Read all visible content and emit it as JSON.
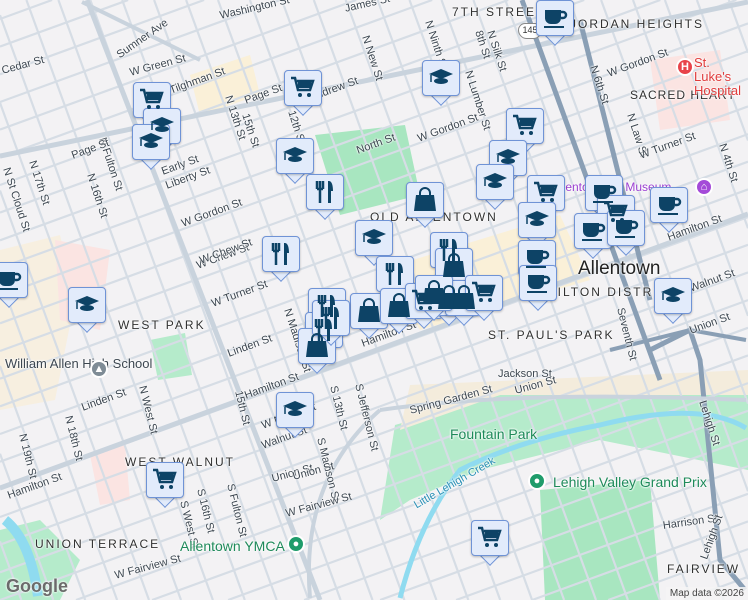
{
  "map": {
    "neighborhoods": [
      "7TH STREET",
      "JORDAN HEIGHTS",
      "SACRED HEART",
      "OLD ALLENTOWN",
      "WEST PARK",
      "ST. PAUL'S PARK",
      "WEST WALNUT",
      "UNION TERRACE",
      "FAIRVIEW",
      "HAMILTON DISTRICT"
    ],
    "city": "Allentown",
    "streets": [
      "Washington St",
      "James St",
      "Sumner Ave",
      "Cedar St",
      "W Green St",
      "Tilghman St",
      "Page St",
      "Andrew St",
      "N 13th St",
      "12th St",
      "N Fulton St",
      "Page St",
      "N 17th St",
      "N 16th St",
      "N St Cloud St",
      "Early St",
      "Liberty St",
      "W Gordon St",
      "W Chew St",
      "North St",
      "N New St",
      "N Ninth St",
      "8th St",
      "N Silk St",
      "N Lumber St",
      "W Gordon St",
      "W Gordon St",
      "N 6th St",
      "N Law St",
      "W Turner St",
      "N 4th St",
      "Hamilton St",
      "Walnut St",
      "Union St",
      "Linden St",
      "Linden St",
      "N Madison St",
      "Hamilton St",
      "Hamilton St",
      "Hamilton St",
      "W Maple St",
      "Walnut St",
      "15th St",
      "S 13th St",
      "S Madison St",
      "S Jefferson St",
      "Union St",
      "W Fairview St",
      "W Fairview St",
      "S Fulton St",
      "S 16th St",
      "S West St",
      "N West St",
      "N 18th St",
      "N 19th St",
      "Jackson St",
      "Union St",
      "Spring Garden St",
      "Harrison St",
      "Lehigh St",
      "Lehigh St",
      "Seventh St",
      "15th St",
      "W Turner St",
      "W Chew St",
      "Union St"
    ],
    "pois": {
      "hospital": "St. Luke's Hospital",
      "museum": "Allentown Art Museum",
      "school": "William Allen High School",
      "park": "Fountain Park",
      "creek": "Little Lehigh Creek",
      "grand_prix": "Lehigh Valley Grand Prix",
      "ymca": "Allentown YMCA"
    },
    "route_shield": "145",
    "markers": [
      "cart",
      "grad",
      "grad",
      "cart",
      "grad",
      "fork",
      "grad",
      "fork",
      "coffee",
      "grad",
      "grad",
      "coffee",
      "cart",
      "grad",
      "grad",
      "bag",
      "cart",
      "coffee",
      "cart",
      "coffee",
      "grad",
      "coffee",
      "coffee",
      "coffee",
      "coffee",
      "grad",
      "fork",
      "fork",
      "fork",
      "bag",
      "fork",
      "bag",
      "bag",
      "bag",
      "cart",
      "bag",
      "bag",
      "cart",
      "bag",
      "fork",
      "grad",
      "cart",
      "cart"
    ],
    "colors": {
      "marker_fill": "#e2ebfb",
      "marker_border": "#6f93d6",
      "icon": "#0d4366",
      "park": "#a8e6c0",
      "water": "#8fdbf0",
      "road": "#d3dbe3",
      "highway": "#8a9fb5"
    },
    "google_logo": "Google",
    "attribution": "Map data ©2026"
  }
}
